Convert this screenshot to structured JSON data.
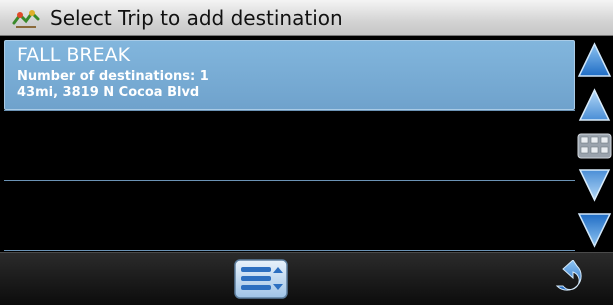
{
  "header": {
    "title": "Select Trip to add destination",
    "icon": "trip-route-icon"
  },
  "trips": [
    {
      "name": "FALL BREAK",
      "destinations_label": "Number of destinations: 1",
      "distance_address": "43mi, 3819 N Cocoa Blvd",
      "selected": true
    }
  ],
  "scroll": {
    "page_up_icon": "arrow-up-icon",
    "line_up_icon": "arrow-up-small-icon",
    "keyboard_icon": "keyboard-icon",
    "line_down_icon": "arrow-down-small-icon",
    "page_down_icon": "arrow-down-icon"
  },
  "footer": {
    "menu_icon": "menu-list-icon",
    "back_icon": "back-arrow-icon"
  },
  "colors": {
    "selected_row": "#78acd6",
    "row_divider": "#6b93b5",
    "arrow_blue": "#2f7fd6",
    "title_bar": "#dcdcdc"
  }
}
